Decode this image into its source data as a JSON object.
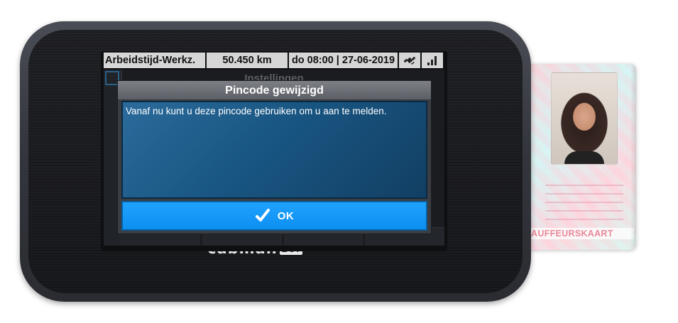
{
  "statusbar": {
    "activity": "Arbeidstijd-Werkz.",
    "distance": "50.450 km",
    "datetime": "do 08:00 | 27-06-2019",
    "gps_icon": "satellite-icon",
    "signal_icon": "signal-bars-icon"
  },
  "background_screen": {
    "title": "Instellingen"
  },
  "dialog": {
    "title": "Pincode gewijzigd",
    "message": "Vanaf nu kunt u deze pincode gebruiken om u aan te melden.",
    "ok_label": "OK",
    "ok_icon": "checkmark-icon"
  },
  "device": {
    "brand": "cabman",
    "badge": "BCT"
  },
  "driver_card": {
    "title": "AUFFEURSKAART"
  },
  "colors": {
    "dialog_body": "#195683",
    "ok_button": "#0b8ef0",
    "title_bar": "#6b6e74",
    "statusbar": "#d6d6d6"
  }
}
